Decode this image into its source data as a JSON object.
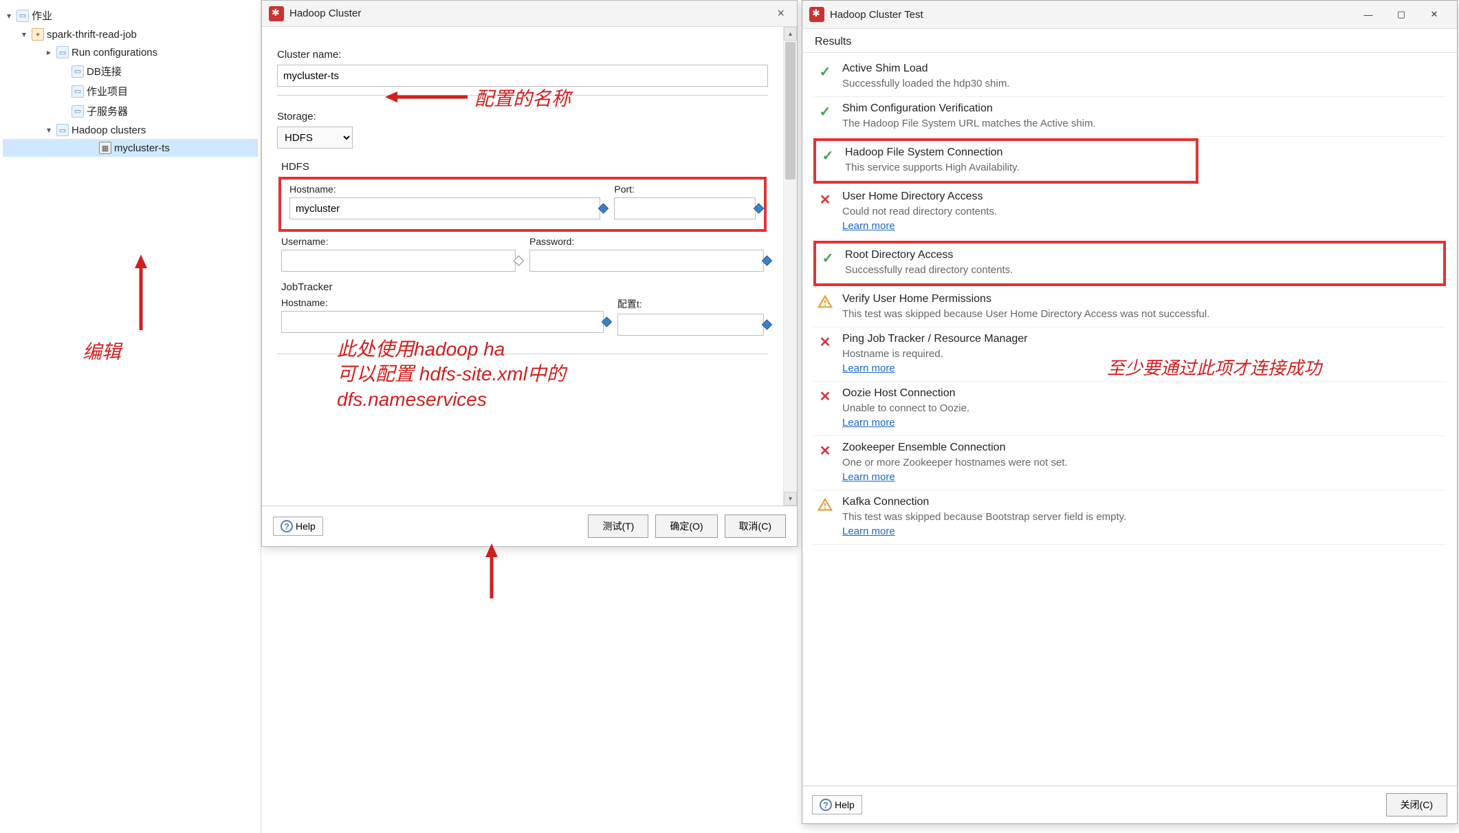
{
  "tree": {
    "root": "作业",
    "job": "spark-thrift-read-job",
    "run_conf": "Run configurations",
    "db_conn": "DB连接",
    "work_items": "作业项目",
    "sub_server": "子服务器",
    "hadoop_clusters": "Hadoop clusters",
    "cluster_item": "mycluster-ts"
  },
  "dialog": {
    "title": "Hadoop Cluster",
    "cluster_name_label": "Cluster name:",
    "cluster_name_value": "mycluster-ts",
    "storage_label": "Storage:",
    "storage_value": "HDFS",
    "hdfs_section": "HDFS",
    "hostname_label": "Hostname:",
    "hostname_value": "mycluster",
    "port_label": "Port:",
    "port_value": "",
    "username_label": "Username:",
    "username_value": "",
    "password_label": "Password:",
    "password_value": "",
    "jobtracker_section": "JobTracker",
    "jt_hostname_label": "Hostname:",
    "jt_hostname_value": "",
    "jt_port_label_partial": "配置t:",
    "jt_port_value": "",
    "help_label": "Help",
    "test_btn": "测试(T)",
    "ok_btn": "确定(O)",
    "cancel_btn": "取消(C)"
  },
  "test": {
    "title": "Hadoop Cluster Test",
    "results_header": "Results",
    "items": [
      {
        "status": "check",
        "title": "Active Shim Load",
        "desc": "Successfully loaded the hdp30 shim."
      },
      {
        "status": "check",
        "title": "Shim Configuration Verification",
        "desc": "The Hadoop File System URL matches the Active shim."
      },
      {
        "status": "check",
        "title": "Hadoop File System Connection",
        "desc": "This service supports High Availability."
      },
      {
        "status": "cross",
        "title": "User Home Directory Access",
        "desc": "Could not read directory contents.",
        "link": "Learn more"
      },
      {
        "status": "check",
        "title": "Root Directory Access",
        "desc": "Successfully read directory contents."
      },
      {
        "status": "warn",
        "title": "Verify User Home Permissions",
        "desc": "This test was skipped because User Home Directory Access was not successful."
      },
      {
        "status": "cross",
        "title": "Ping Job Tracker / Resource Manager",
        "desc": "Hostname is required.",
        "link": "Learn more"
      },
      {
        "status": "cross",
        "title": "Oozie Host Connection",
        "desc": "Unable to connect to Oozie.",
        "link": "Learn more"
      },
      {
        "status": "cross",
        "title": "Zookeeper Ensemble Connection",
        "desc": "One or more Zookeeper hostnames were not set.",
        "link": "Learn more"
      },
      {
        "status": "warn",
        "title": "Kafka Connection",
        "desc": "This test was skipped because Bootstrap server field is empty.",
        "link": "Learn more"
      }
    ],
    "help_label": "Help",
    "close_btn": "关闭(C)"
  },
  "annotations": {
    "config_name": "配置的名称",
    "edit": "编辑",
    "hdfs_note_1": "此处使用hadoop ha",
    "hdfs_note_2": "可以配置 hdfs-site.xml中的",
    "hdfs_note_3": "dfs.nameservices",
    "success_note": "至少要通过此项才连接成功"
  },
  "glyphs": {
    "down": "▾",
    "right": "▸",
    "check": "✓",
    "cross": "✕"
  }
}
